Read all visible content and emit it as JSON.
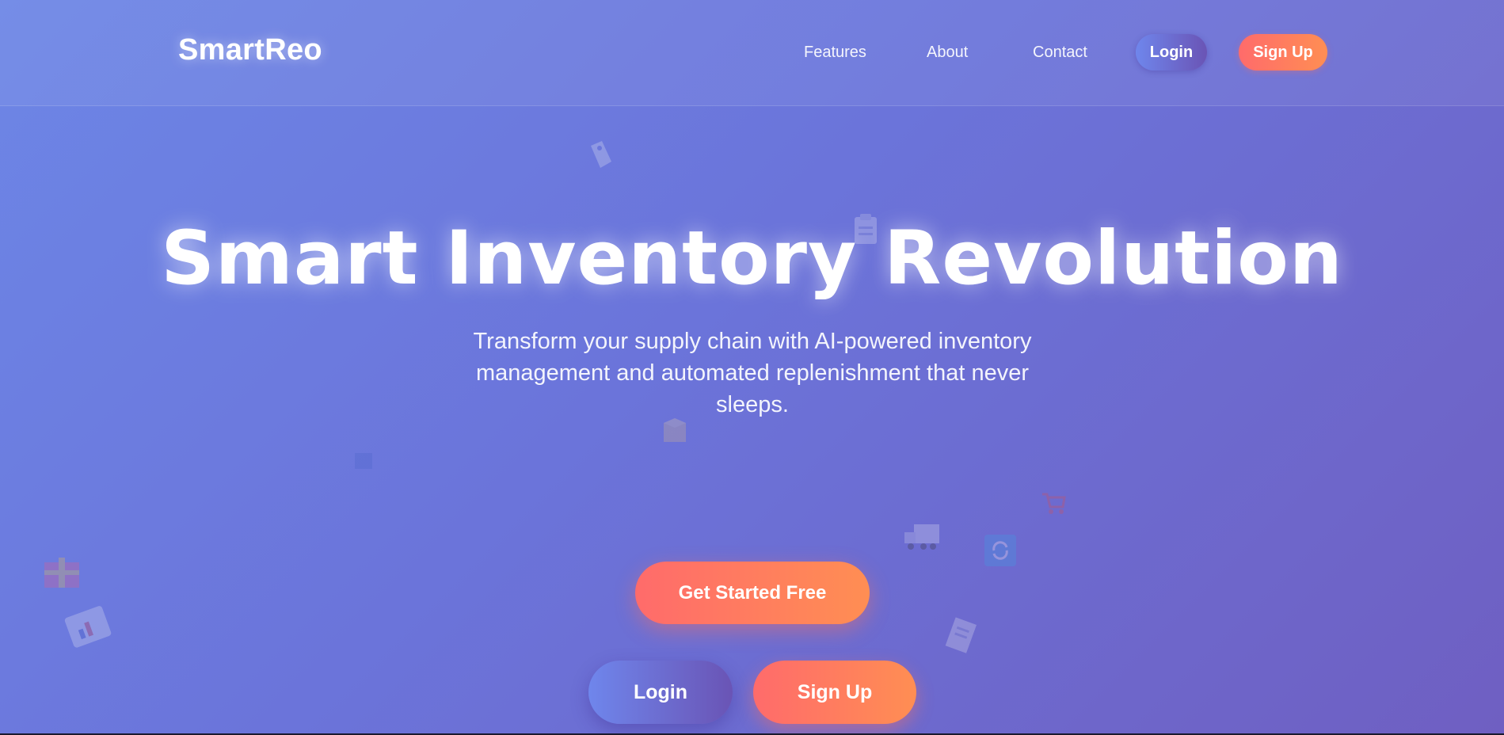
{
  "nav": {
    "brand": "SmartReo",
    "links": [
      "Features",
      "About",
      "Contact"
    ],
    "login_label": "Login",
    "signup_label": "Sign Up"
  },
  "hero": {
    "title": "Smart Inventory Revolution",
    "subtitle": "Transform your supply chain with AI-powered inventory management and automated replenishment that never sleeps.",
    "cta_label": "Get Started Free",
    "login_label": "Login",
    "signup_label": "Sign Up"
  },
  "decor_icons": [
    "tag-icon",
    "clipboard-icon",
    "package-icon",
    "box-icon",
    "truck-icon",
    "refresh-icon",
    "chart-icon",
    "gift-icon",
    "document-icon",
    "cart-icon"
  ],
  "colors": {
    "accent_start": "#ff6b6b",
    "accent_end": "#ff8e53",
    "login_start": "#6f86ec",
    "login_end": "#6a54b5"
  }
}
